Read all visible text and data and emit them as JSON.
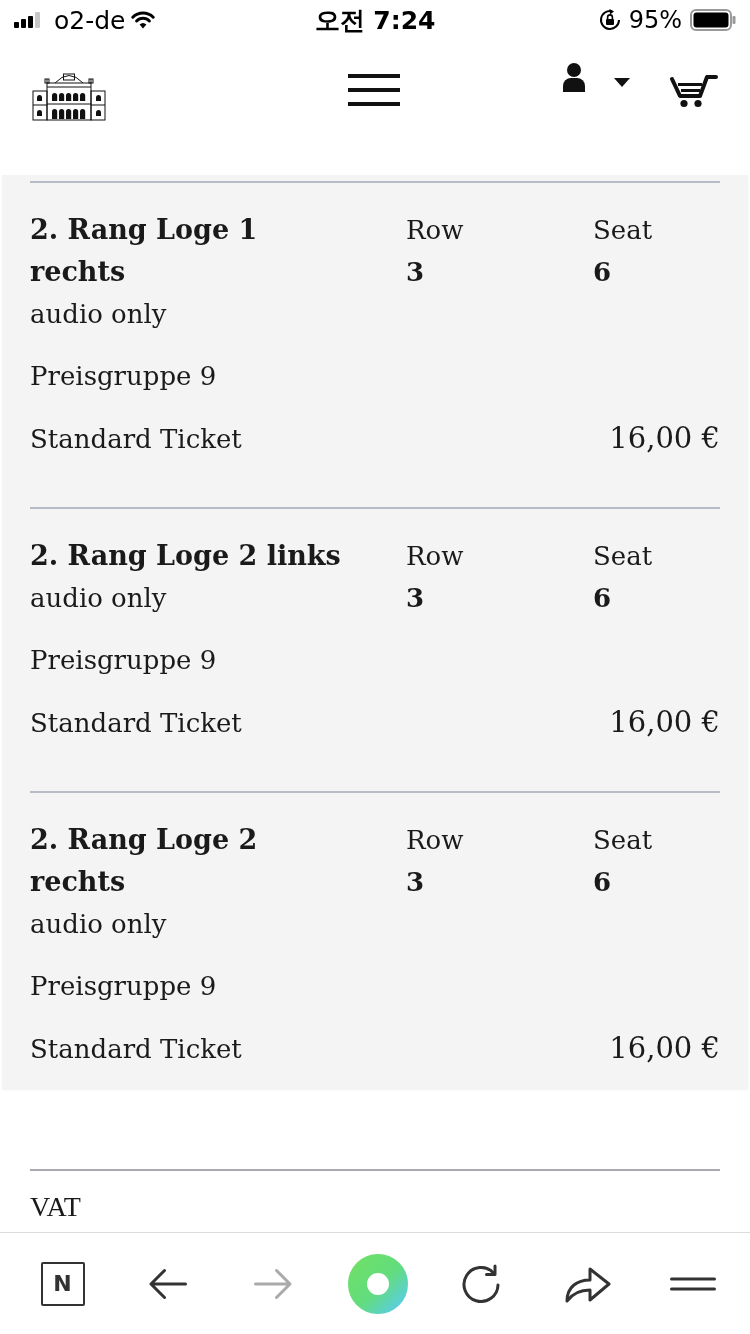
{
  "status_bar": {
    "carrier": "o2-de",
    "time": "오전 7:24",
    "battery": "95%"
  },
  "tickets": [
    {
      "title": "2. Rang Loge 1 rechts",
      "note": "audio only",
      "row_label": "Row",
      "row": "3",
      "seat_label": "Seat",
      "seat": "6",
      "price_group": "Preisgruppe 9",
      "ticket_type": "Standard Ticket",
      "price": "16,00 €"
    },
    {
      "title": "2. Rang Loge 2 links",
      "note": "audio only",
      "row_label": "Row",
      "row": "3",
      "seat_label": "Seat",
      "seat": "6",
      "price_group": "Preisgruppe 9",
      "ticket_type": "Standard Ticket",
      "price": "16,00 €"
    },
    {
      "title": "2. Rang Loge 2 rechts",
      "note": "audio only",
      "row_label": "Row",
      "row": "3",
      "seat_label": "Seat",
      "seat": "6",
      "price_group": "Preisgruppe 9",
      "ticket_type": "Standard Ticket",
      "price": "16,00 €"
    }
  ],
  "summary": {
    "vat_label": "VAT"
  },
  "toolbar": [
    {
      "kind": "tabs",
      "label": "N",
      "disabled": false
    },
    {
      "kind": "back",
      "disabled": false
    },
    {
      "kind": "forward",
      "disabled": true
    },
    {
      "kind": "home",
      "disabled": false
    },
    {
      "kind": "reload",
      "disabled": false
    },
    {
      "kind": "share",
      "disabled": false
    },
    {
      "kind": "menu",
      "disabled": false
    }
  ]
}
